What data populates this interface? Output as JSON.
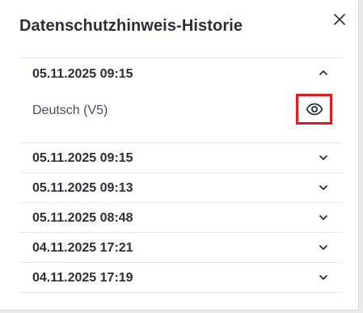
{
  "dialog": {
    "title": "Datenschutzhinweis-Historie",
    "close_icon": "close-icon"
  },
  "history": [
    {
      "label": "05.11.2025 09:15",
      "expanded": true,
      "detail": "Deutsch (V5)",
      "action_icon": "eye-icon"
    },
    {
      "label": "05.11.2025 09:15",
      "expanded": false
    },
    {
      "label": "05.11.2025 09:13",
      "expanded": false
    },
    {
      "label": "05.11.2025 08:48",
      "expanded": false
    },
    {
      "label": "04.11.2025 17:21",
      "expanded": false
    },
    {
      "label": "04.11.2025 17:19",
      "expanded": false
    }
  ],
  "colors": {
    "text": "#2b2f38",
    "highlight": "#d81e1e",
    "divider": "#e3e5e8"
  }
}
